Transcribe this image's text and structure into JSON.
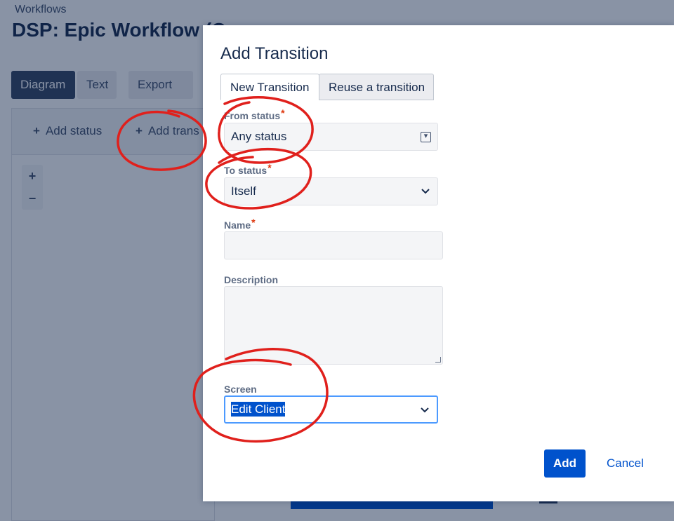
{
  "background": {
    "breadcrumb": "Workflows",
    "page_title": "DSP: Epic Workflow (C",
    "view_buttons": {
      "diagram": "Diagram",
      "text": "Text",
      "export": "Export"
    },
    "toolbar": {
      "add_status": "Add status",
      "add_transition": "Add trans"
    },
    "zoom": {
      "in": "+",
      "out": "−"
    }
  },
  "dialog": {
    "title": "Add Transition",
    "tabs": {
      "new": "New Transition",
      "reuse": "Reuse a transition"
    },
    "fields": {
      "from_status": {
        "label": "From status",
        "required": "*",
        "value": "Any status"
      },
      "to_status": {
        "label": "To status",
        "required": "*",
        "value": "Itself"
      },
      "name": {
        "label": "Name",
        "required": "*",
        "value": ""
      },
      "description": {
        "label": "Description",
        "value": ""
      },
      "screen": {
        "label": "Screen",
        "value": "Edit Client"
      }
    },
    "buttons": {
      "add": "Add",
      "cancel": "Cancel"
    }
  },
  "colors": {
    "primary": "#0052cc",
    "annotation": "#e0201c",
    "overlay": "#8b93a5"
  }
}
